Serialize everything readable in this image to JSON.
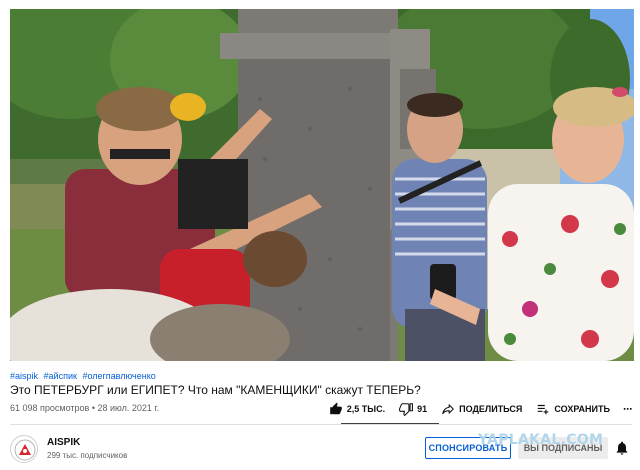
{
  "video": {
    "thumbnail_icon": "video-frame"
  },
  "hashtags": [
    "#aispik",
    "#айспик",
    "#олегпавлюченко"
  ],
  "title": "Это ПЕТЕРБУРГ или ЕГИПЕТ? Что нам \"КАМЕНЩИКИ\" скажут ТЕПЕРЬ?",
  "meta": {
    "views": "61 098 просмотров",
    "separator": "•",
    "date": "28 июл. 2021 г."
  },
  "actions": {
    "likes": "2,5 ТЫС.",
    "dislikes": "91",
    "share": "ПОДЕЛИТЬСЯ",
    "save": "СОХРАНИТЬ",
    "more": "⋯"
  },
  "channel": {
    "name": "AISPIK",
    "subscribers": "299 тыс. подписчиков"
  },
  "buttons": {
    "sponsor": "СПОНСИРОВАТЬ",
    "subscribed": "ВЫ ПОДПИСАНЫ"
  },
  "watermark": "YAPLAKAL.COM",
  "colors": {
    "link": "#065fd4",
    "text": "#0f0f0f",
    "secondary": "#606060"
  }
}
